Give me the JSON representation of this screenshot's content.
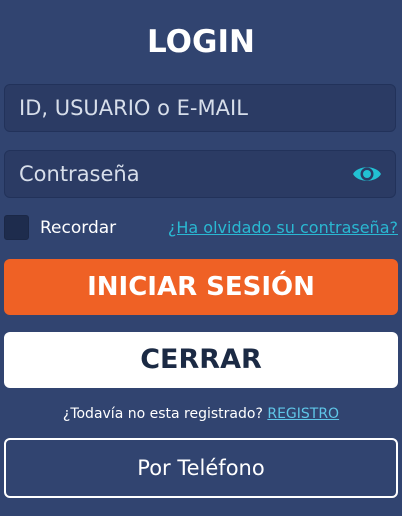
{
  "title": "LOGIN",
  "user_field": {
    "placeholder": "ID, USUARIO o E-MAIL",
    "value": ""
  },
  "password_field": {
    "placeholder": "Contraseña",
    "value": ""
  },
  "remember": {
    "label": "Recordar",
    "checked": false
  },
  "forgot_link": "¿Ha olvidado su contraseña?",
  "login_button": "INICIAR SESIÓN",
  "close_button": "CERRAR",
  "register": {
    "prompt": "¿Todavía no esta registrado?",
    "link": "REGISTRO"
  },
  "phone_button": "Por Teléfono",
  "icons": {
    "password_toggle": "eye-icon"
  },
  "colors": {
    "background": "#314470",
    "input_background": "#2b3b64",
    "accent_orange": "#ef6125",
    "link_cyan": "#2ab8d2",
    "eye_icon": "#22c1d3"
  }
}
